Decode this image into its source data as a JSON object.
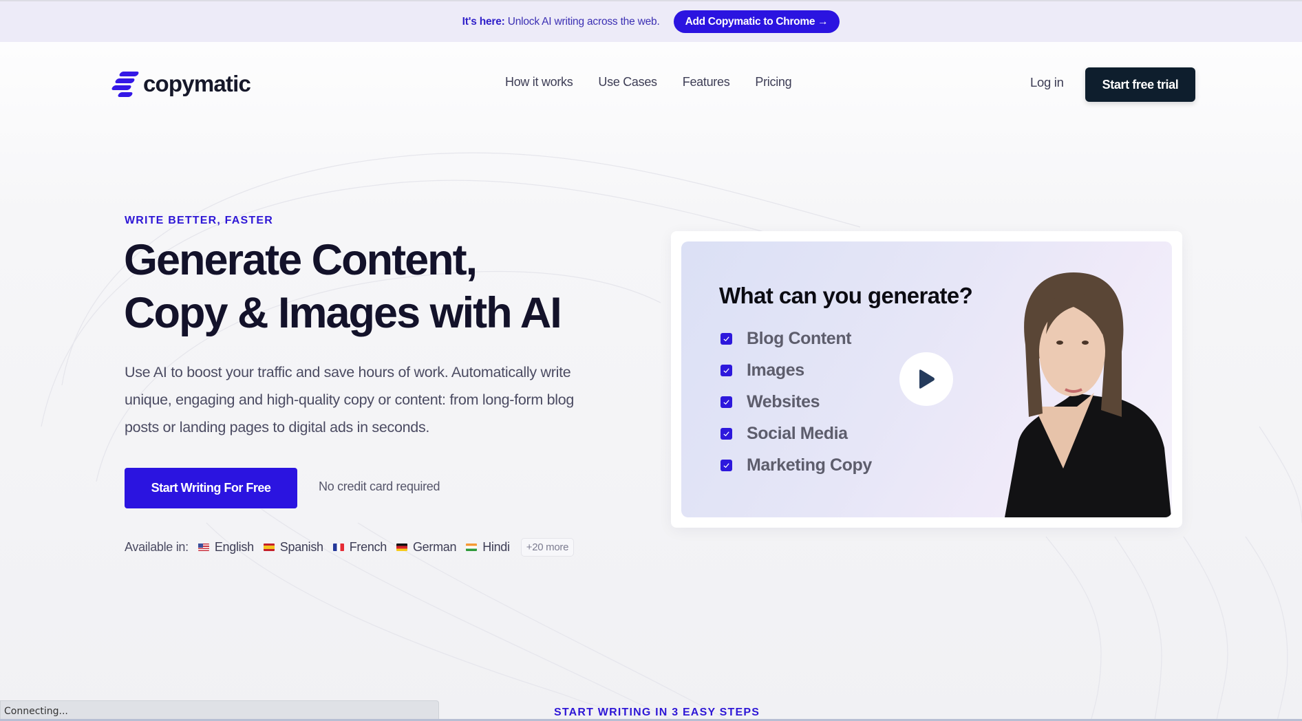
{
  "banner": {
    "prefix": "It's here:",
    "text": " Unlock AI writing across the web.",
    "button_label": "Add Copymatic to Chrome →"
  },
  "header": {
    "logo_text": "copymatic",
    "nav": [
      {
        "label": "How it works"
      },
      {
        "label": "Use Cases"
      },
      {
        "label": "Features"
      },
      {
        "label": "Pricing"
      }
    ],
    "login_label": "Log in",
    "trial_label": "Start free trial"
  },
  "hero": {
    "eyebrow": "WRITE BETTER, FASTER",
    "headline_line1": "Generate Content,",
    "headline_line2": "Copy & Images with AI",
    "lead": "Use AI to boost your traffic and save hours of work. Automatically write unique, engaging and high-quality copy or content: from long-form blog posts or landing pages to digital ads in seconds.",
    "cta_label": "Start Writing For Free",
    "no_card_note": "No credit card required",
    "languages_label": "Available in:",
    "languages": [
      {
        "name": "English",
        "flag": "us-flag-icon"
      },
      {
        "name": "Spanish",
        "flag": "es-flag-icon"
      },
      {
        "name": "French",
        "flag": "fr-flag-icon"
      },
      {
        "name": "German",
        "flag": "de-flag-icon"
      },
      {
        "name": "Hindi",
        "flag": "in-flag-icon"
      }
    ],
    "more_languages": "+20 more"
  },
  "video": {
    "title": "What can you generate?",
    "items": [
      {
        "label": "Blog Content",
        "checked": true
      },
      {
        "label": "Images",
        "checked": true
      },
      {
        "label": "Websites",
        "checked": true
      },
      {
        "label": "Social Media",
        "checked": true
      },
      {
        "label": "Marketing Copy",
        "checked": true
      }
    ],
    "play_icon": "play-icon"
  },
  "next_section": {
    "eyebrow": "START WRITING IN 3 EASY STEPS"
  },
  "browser_status": {
    "text": "Connecting..."
  },
  "colors": {
    "accent": "#2b14e0",
    "dark_button": "#0e1e2d",
    "banner_bg": "#edebf8",
    "heading": "#13122a"
  }
}
